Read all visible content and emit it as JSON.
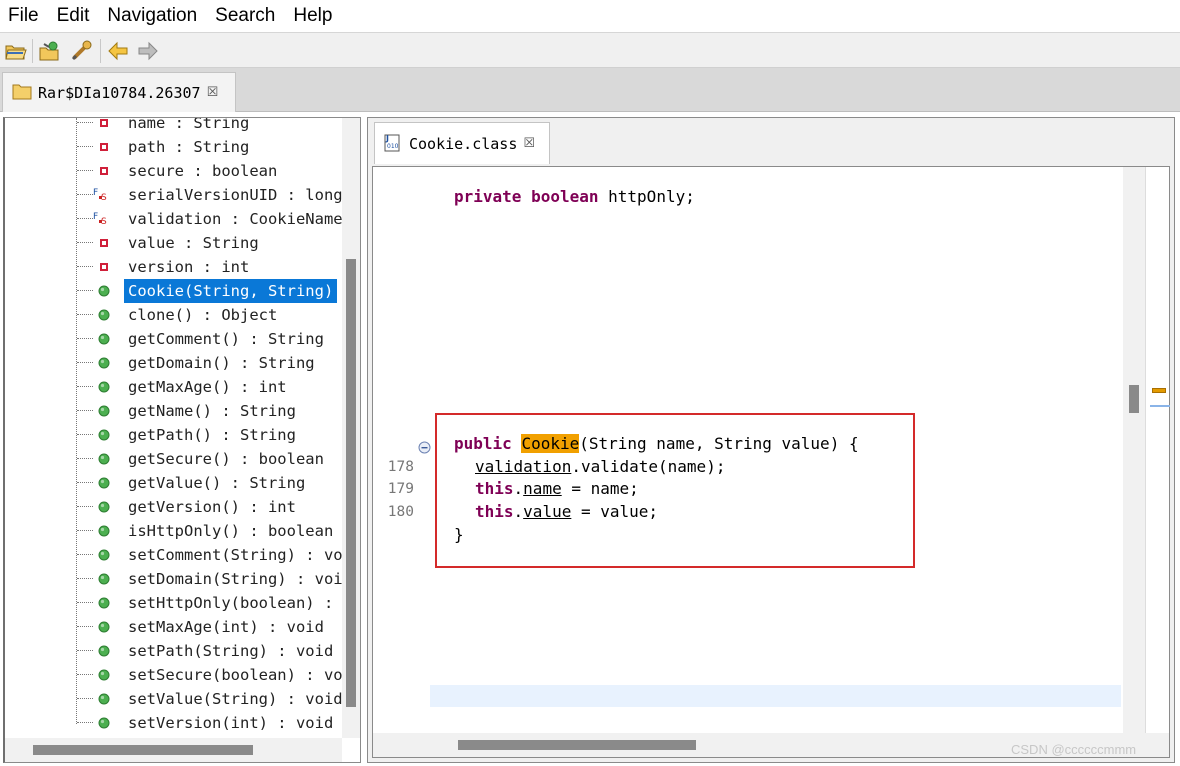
{
  "menu": [
    "File",
    "Edit",
    "Navigation",
    "Search",
    "Help"
  ],
  "toolbar": {
    "buttons": [
      "open-file-icon",
      "open-type-icon",
      "open-type-hierarchy-icon",
      "back-arrow-icon",
      "forward-arrow-icon"
    ]
  },
  "file_tab": {
    "label": "Rar$DIa10784.26307",
    "close": "☒"
  },
  "tree": {
    "items": [
      {
        "label": "name : String",
        "icon": "private-field-icon"
      },
      {
        "label": "path : String",
        "icon": "private-field-icon"
      },
      {
        "label": "secure : boolean",
        "icon": "private-field-icon"
      },
      {
        "label": "serialVersionUID : long",
        "icon": "static-final-field-icon"
      },
      {
        "label": "validation : CookieNameV",
        "icon": "static-final-field-icon"
      },
      {
        "label": "value : String",
        "icon": "private-field-icon"
      },
      {
        "label": "version : int",
        "icon": "private-field-icon"
      },
      {
        "label": "Cookie(String, String)",
        "icon": "public-method-icon",
        "selected": true
      },
      {
        "label": "clone() : Object",
        "icon": "public-method-icon"
      },
      {
        "label": "getComment() : String",
        "icon": "public-method-icon"
      },
      {
        "label": "getDomain() : String",
        "icon": "public-method-icon"
      },
      {
        "label": "getMaxAge() : int",
        "icon": "public-method-icon"
      },
      {
        "label": "getName() : String",
        "icon": "public-method-icon"
      },
      {
        "label": "getPath() : String",
        "icon": "public-method-icon"
      },
      {
        "label": "getSecure() : boolean",
        "icon": "public-method-icon"
      },
      {
        "label": "getValue() : String",
        "icon": "public-method-icon"
      },
      {
        "label": "getVersion() : int",
        "icon": "public-method-icon"
      },
      {
        "label": "isHttpOnly() : boolean",
        "icon": "public-method-icon"
      },
      {
        "label": "setComment(String) : voi",
        "icon": "public-method-icon"
      },
      {
        "label": "setDomain(String) : voic",
        "icon": "public-method-icon"
      },
      {
        "label": "setHttpOnly(boolean) : v",
        "icon": "public-method-icon"
      },
      {
        "label": "setMaxAge(int) : void",
        "icon": "public-method-icon"
      },
      {
        "label": "setPath(String) : void",
        "icon": "public-method-icon"
      },
      {
        "label": "setSecure(boolean) : voi",
        "icon": "public-method-icon"
      },
      {
        "label": "setValue(String) : void",
        "icon": "public-method-icon"
      },
      {
        "label": "setVersion(int) : void",
        "icon": "public-method-icon"
      }
    ]
  },
  "editor": {
    "tab_label": "Cookie.class",
    "tab_close": "☒",
    "field_line": {
      "kw1": "private",
      "kw2": "boolean",
      "rest": " httpOnly;"
    },
    "constructor": {
      "kw_public": "public",
      "name": "Cookie",
      "params": "(String name, String value) {",
      "line1_field": "validation",
      "line1_rest": ".validate(name);",
      "kw_this": "this",
      "line2_field": "name",
      "line2_rest": " = name;",
      "line3_field": "value",
      "line3_rest": " = value;",
      "close_brace": "}"
    },
    "line_numbers": [
      "178",
      "179",
      "180"
    ]
  },
  "watermark": "CSDN @ccccccmmm",
  "colors": {
    "selection": "#0a78d7",
    "keyword": "#7f0055",
    "occurrence_highlight": "#f1a000",
    "annotation_box": "#d42a2a"
  }
}
